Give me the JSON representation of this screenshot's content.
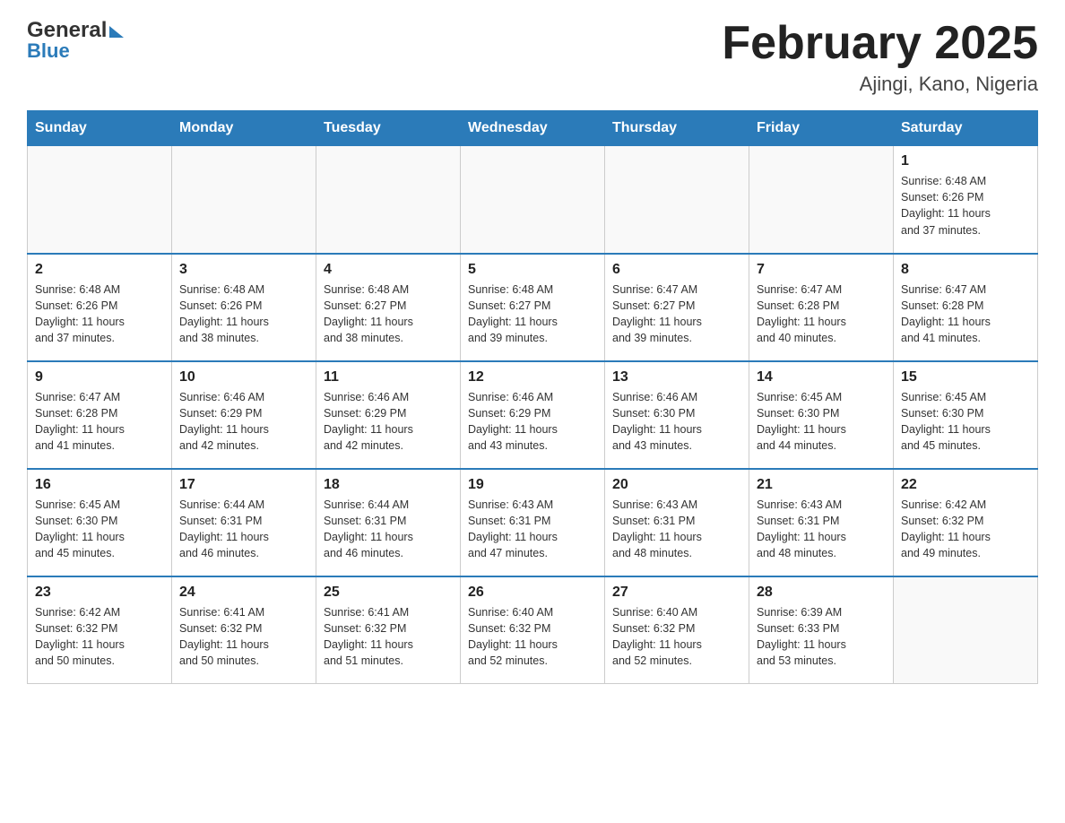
{
  "header": {
    "logo_general": "General",
    "logo_blue": "Blue",
    "title": "February 2025",
    "subtitle": "Ajingi, Kano, Nigeria"
  },
  "days_of_week": [
    "Sunday",
    "Monday",
    "Tuesday",
    "Wednesday",
    "Thursday",
    "Friday",
    "Saturday"
  ],
  "weeks": [
    {
      "days": [
        {
          "date": "",
          "info": ""
        },
        {
          "date": "",
          "info": ""
        },
        {
          "date": "",
          "info": ""
        },
        {
          "date": "",
          "info": ""
        },
        {
          "date": "",
          "info": ""
        },
        {
          "date": "",
          "info": ""
        },
        {
          "date": "1",
          "info": "Sunrise: 6:48 AM\nSunset: 6:26 PM\nDaylight: 11 hours\nand 37 minutes."
        }
      ]
    },
    {
      "days": [
        {
          "date": "2",
          "info": "Sunrise: 6:48 AM\nSunset: 6:26 PM\nDaylight: 11 hours\nand 37 minutes."
        },
        {
          "date": "3",
          "info": "Sunrise: 6:48 AM\nSunset: 6:26 PM\nDaylight: 11 hours\nand 38 minutes."
        },
        {
          "date": "4",
          "info": "Sunrise: 6:48 AM\nSunset: 6:27 PM\nDaylight: 11 hours\nand 38 minutes."
        },
        {
          "date": "5",
          "info": "Sunrise: 6:48 AM\nSunset: 6:27 PM\nDaylight: 11 hours\nand 39 minutes."
        },
        {
          "date": "6",
          "info": "Sunrise: 6:47 AM\nSunset: 6:27 PM\nDaylight: 11 hours\nand 39 minutes."
        },
        {
          "date": "7",
          "info": "Sunrise: 6:47 AM\nSunset: 6:28 PM\nDaylight: 11 hours\nand 40 minutes."
        },
        {
          "date": "8",
          "info": "Sunrise: 6:47 AM\nSunset: 6:28 PM\nDaylight: 11 hours\nand 41 minutes."
        }
      ]
    },
    {
      "days": [
        {
          "date": "9",
          "info": "Sunrise: 6:47 AM\nSunset: 6:28 PM\nDaylight: 11 hours\nand 41 minutes."
        },
        {
          "date": "10",
          "info": "Sunrise: 6:46 AM\nSunset: 6:29 PM\nDaylight: 11 hours\nand 42 minutes."
        },
        {
          "date": "11",
          "info": "Sunrise: 6:46 AM\nSunset: 6:29 PM\nDaylight: 11 hours\nand 42 minutes."
        },
        {
          "date": "12",
          "info": "Sunrise: 6:46 AM\nSunset: 6:29 PM\nDaylight: 11 hours\nand 43 minutes."
        },
        {
          "date": "13",
          "info": "Sunrise: 6:46 AM\nSunset: 6:30 PM\nDaylight: 11 hours\nand 43 minutes."
        },
        {
          "date": "14",
          "info": "Sunrise: 6:45 AM\nSunset: 6:30 PM\nDaylight: 11 hours\nand 44 minutes."
        },
        {
          "date": "15",
          "info": "Sunrise: 6:45 AM\nSunset: 6:30 PM\nDaylight: 11 hours\nand 45 minutes."
        }
      ]
    },
    {
      "days": [
        {
          "date": "16",
          "info": "Sunrise: 6:45 AM\nSunset: 6:30 PM\nDaylight: 11 hours\nand 45 minutes."
        },
        {
          "date": "17",
          "info": "Sunrise: 6:44 AM\nSunset: 6:31 PM\nDaylight: 11 hours\nand 46 minutes."
        },
        {
          "date": "18",
          "info": "Sunrise: 6:44 AM\nSunset: 6:31 PM\nDaylight: 11 hours\nand 46 minutes."
        },
        {
          "date": "19",
          "info": "Sunrise: 6:43 AM\nSunset: 6:31 PM\nDaylight: 11 hours\nand 47 minutes."
        },
        {
          "date": "20",
          "info": "Sunrise: 6:43 AM\nSunset: 6:31 PM\nDaylight: 11 hours\nand 48 minutes."
        },
        {
          "date": "21",
          "info": "Sunrise: 6:43 AM\nSunset: 6:31 PM\nDaylight: 11 hours\nand 48 minutes."
        },
        {
          "date": "22",
          "info": "Sunrise: 6:42 AM\nSunset: 6:32 PM\nDaylight: 11 hours\nand 49 minutes."
        }
      ]
    },
    {
      "days": [
        {
          "date": "23",
          "info": "Sunrise: 6:42 AM\nSunset: 6:32 PM\nDaylight: 11 hours\nand 50 minutes."
        },
        {
          "date": "24",
          "info": "Sunrise: 6:41 AM\nSunset: 6:32 PM\nDaylight: 11 hours\nand 50 minutes."
        },
        {
          "date": "25",
          "info": "Sunrise: 6:41 AM\nSunset: 6:32 PM\nDaylight: 11 hours\nand 51 minutes."
        },
        {
          "date": "26",
          "info": "Sunrise: 6:40 AM\nSunset: 6:32 PM\nDaylight: 11 hours\nand 52 minutes."
        },
        {
          "date": "27",
          "info": "Sunrise: 6:40 AM\nSunset: 6:32 PM\nDaylight: 11 hours\nand 52 minutes."
        },
        {
          "date": "28",
          "info": "Sunrise: 6:39 AM\nSunset: 6:33 PM\nDaylight: 11 hours\nand 53 minutes."
        },
        {
          "date": "",
          "info": ""
        }
      ]
    }
  ]
}
